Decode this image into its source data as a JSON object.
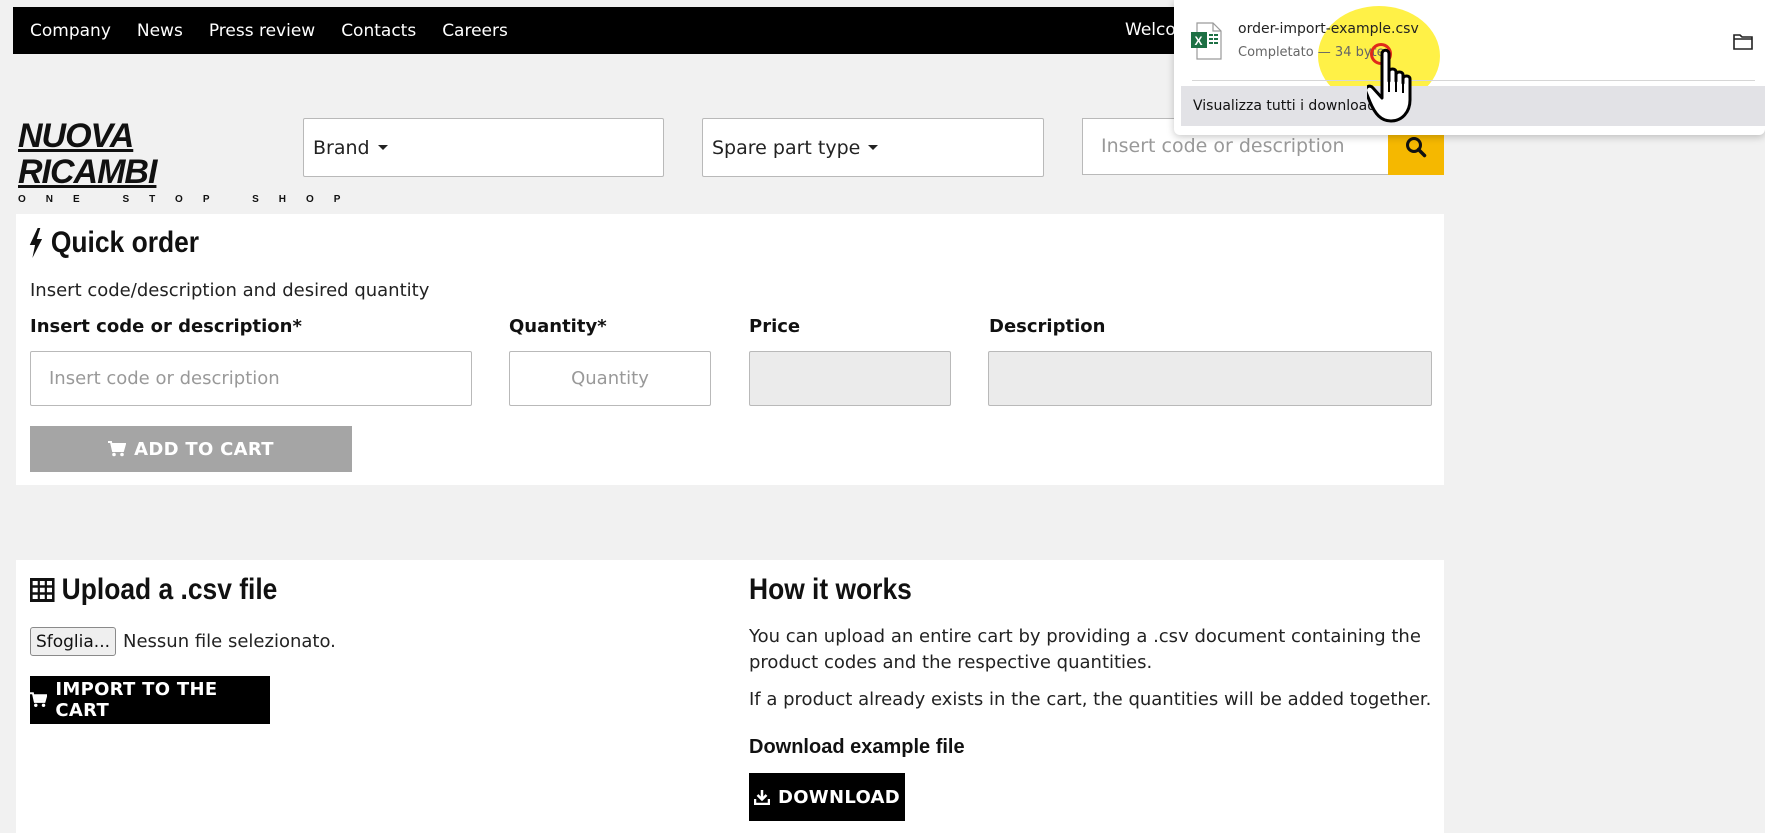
{
  "nav": {
    "items": [
      "Company",
      "News",
      "Press review",
      "Contacts",
      "Careers"
    ],
    "welcome": "Welco"
  },
  "logo": {
    "main": "NUOVA RICAMBI",
    "tagline": "ONE STOP SHOP"
  },
  "filters": {
    "brand": "Brand",
    "spare_part_type": "Spare part type",
    "search_placeholder": "Insert code or description"
  },
  "quick_order": {
    "title": "Quick order",
    "subtitle": "Insert code/description and desired quantity",
    "code_label": "Insert code or description*",
    "quantity_label": "Quantity*",
    "price_label": "Price",
    "description_label": "Description",
    "code_placeholder": "Insert code or description",
    "quantity_placeholder": "Quantity",
    "add_to_cart": "ADD TO CART"
  },
  "upload": {
    "title": "Upload a .csv file",
    "browse_button": "Sfoglia...",
    "no_file": "Nessun file selezionato.",
    "import_button": "IMPORT TO THE CART"
  },
  "how_it_works": {
    "title": "How it works",
    "line1": "You can upload an entire cart by providing a .csv document containing the",
    "line2": "product codes and the respective quantities.",
    "line3": "If a product already exists in the cart, the quantities will be added together.",
    "download_label": "Download example file",
    "download_button": "DOWNLOAD"
  },
  "download_popup": {
    "filename": "order-import-example.csv",
    "status": "Completato — 34 byte",
    "show_all": "Visualizza tutti i download"
  },
  "colors": {
    "accent": "#f5b800",
    "nav_bg": "#000000",
    "excel_green": "#1d7044"
  }
}
